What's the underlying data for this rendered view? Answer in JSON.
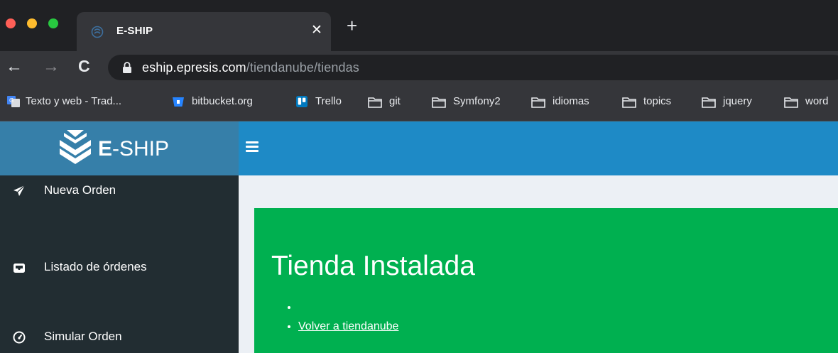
{
  "browser": {
    "tab": {
      "title": "E-SHIP",
      "close": "✕"
    },
    "new_tab": "+",
    "nav": {
      "back": "←",
      "forward": "→",
      "reload": "C"
    },
    "url": {
      "host": "eship.epresis.com",
      "path": "/tiendanube/tiendas"
    },
    "bookmarks": [
      {
        "label": "Texto y web - Trad...",
        "icon": "google-translate-icon"
      },
      {
        "label": "bitbucket.org",
        "icon": "bitbucket-icon"
      },
      {
        "label": "Trello",
        "icon": "trello-icon"
      },
      {
        "label": "git",
        "icon": "folder-icon"
      },
      {
        "label": "Symfony2",
        "icon": "folder-icon"
      },
      {
        "label": "idiomas",
        "icon": "folder-icon"
      },
      {
        "label": "topics",
        "icon": "folder-icon"
      },
      {
        "label": "jquery",
        "icon": "folder-icon"
      },
      {
        "label": "word",
        "icon": "folder-icon"
      }
    ]
  },
  "app": {
    "logo": {
      "bold": "E",
      "rest": "-SHIP"
    },
    "menu": [
      {
        "label": "Nueva Orden",
        "icon": "paper-plane-icon"
      },
      {
        "label": "Listado de órdenes",
        "icon": "inbox-icon"
      },
      {
        "label": "Simular Orden",
        "icon": "dashboard-gauge-icon"
      }
    ],
    "callout": {
      "title": "Tienda Instalada",
      "items": [
        "",
        "Volver a tiendanube"
      ]
    }
  },
  "colors": {
    "browser_bg": "#202124",
    "toolbar_bg": "#35363a",
    "logo_bg": "#367fa9",
    "topbar_bg": "#1e8ac6",
    "sidebar_bg": "#222d32",
    "content_bg": "#ecf0f5",
    "callout_bg": "#00b050"
  }
}
